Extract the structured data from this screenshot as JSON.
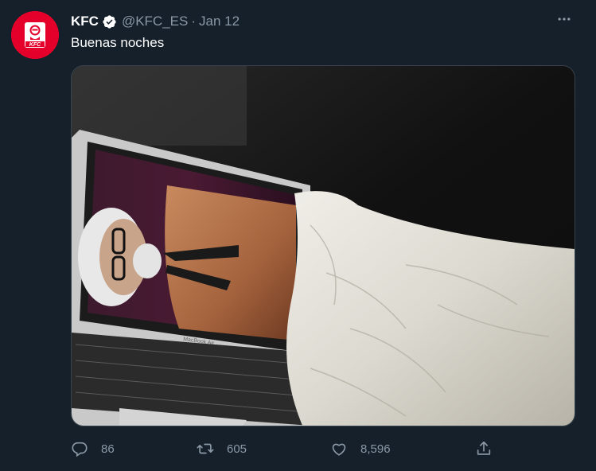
{
  "tweet": {
    "author_name": "KFC",
    "handle": "@KFC_ES",
    "separator": "·",
    "date": "Jan 12",
    "text": "Buenas noches",
    "avatar_text": "KFC",
    "laptop_brand": "MacBook Air",
    "stats": {
      "replies": "86",
      "retweets": "605",
      "likes": "8,596"
    }
  },
  "icons": {
    "verified": "verified-badge-icon",
    "more": "more-options-icon",
    "reply": "reply-icon",
    "retweet": "retweet-icon",
    "like": "heart-icon",
    "share": "share-icon"
  },
  "colors": {
    "background": "#15202b",
    "text_primary": "#ffffff",
    "text_secondary": "#8b98a5",
    "brand_red": "#e4002b",
    "border": "#38444d"
  }
}
